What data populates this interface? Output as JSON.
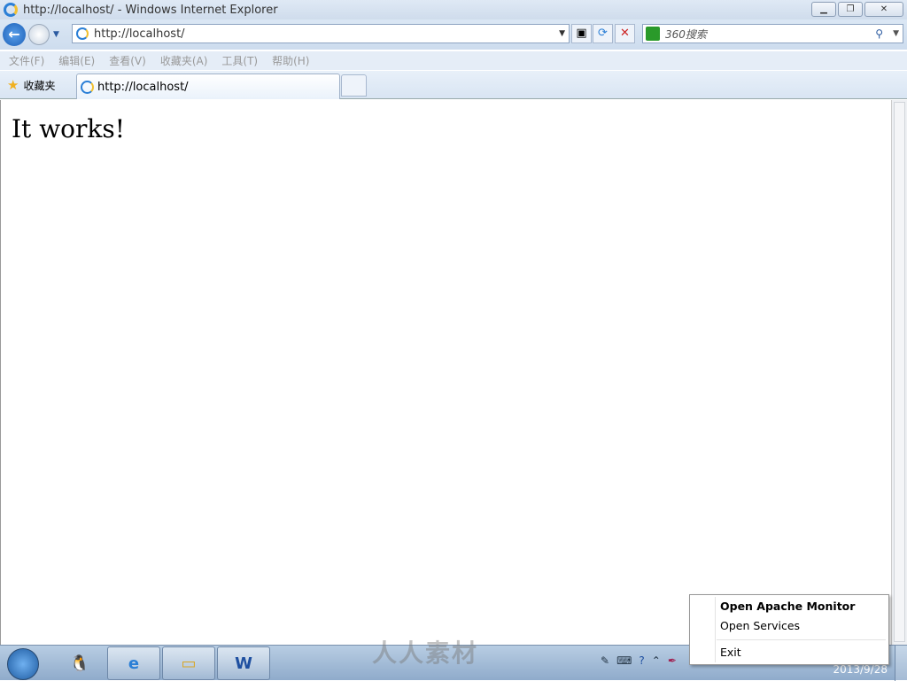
{
  "window": {
    "title": "http://localhost/ - Windows Internet Explorer",
    "controls": [
      "minimize",
      "restore",
      "close"
    ]
  },
  "nav": {
    "address": "http://localhost/",
    "search_placeholder": "360搜索"
  },
  "menu": [
    "文件(F)",
    "编辑(E)",
    "查看(V)",
    "收藏夹(A)",
    "工具(T)",
    "帮助(H)"
  ],
  "favorites_label": "收藏夹",
  "tab": {
    "label": "http://localhost/"
  },
  "page": {
    "heading": "It works!"
  },
  "context_menu": {
    "items": [
      "Open Apache Monitor",
      "Open Services",
      "Exit"
    ]
  },
  "taskbar": {
    "clock_date": "2013/9/28",
    "apps": [
      "qq",
      "internet-explorer",
      "file-explorer",
      "word"
    ]
  },
  "watermark": "人人素材"
}
